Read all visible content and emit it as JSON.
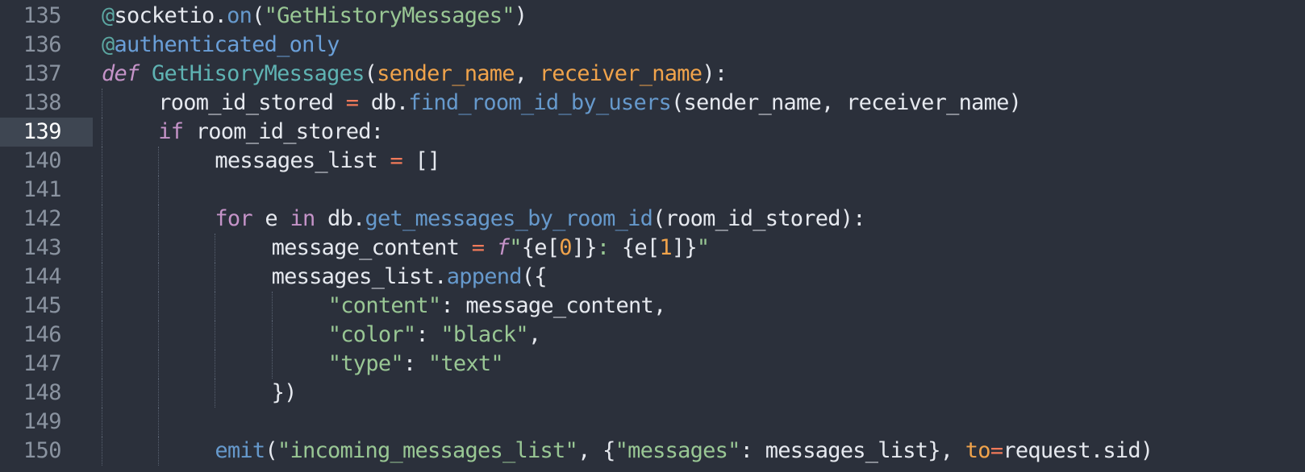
{
  "editor": {
    "active_line": "139",
    "lines": [
      {
        "number": "135",
        "indent": 0,
        "tokens": [
          {
            "c": "t-decorator",
            "t": "@"
          },
          {
            "c": "t-plain",
            "t": "socketio"
          },
          {
            "c": "t-punct",
            "t": "."
          },
          {
            "c": "t-method",
            "t": "on"
          },
          {
            "c": "t-punct",
            "t": "("
          },
          {
            "c": "t-string",
            "t": "\"GetHistoryMessages\""
          },
          {
            "c": "t-punct",
            "t": ")"
          }
        ]
      },
      {
        "number": "136",
        "indent": 0,
        "tokens": [
          {
            "c": "t-decorator",
            "t": "@"
          },
          {
            "c": "t-decorator-name",
            "t": "authenticated_only"
          }
        ]
      },
      {
        "number": "137",
        "indent": 0,
        "tokens": [
          {
            "c": "t-def",
            "t": "def"
          },
          {
            "c": "t-plain",
            "t": " "
          },
          {
            "c": "t-func",
            "t": "GetHisoryMessages"
          },
          {
            "c": "t-punct",
            "t": "("
          },
          {
            "c": "t-param",
            "t": "sender_name"
          },
          {
            "c": "t-punct",
            "t": ", "
          },
          {
            "c": "t-param",
            "t": "receiver_name"
          },
          {
            "c": "t-punct",
            "t": "):"
          }
        ]
      },
      {
        "number": "138",
        "indent": 1,
        "tokens": [
          {
            "c": "t-plain",
            "t": "room_id_stored "
          },
          {
            "c": "t-operator",
            "t": "="
          },
          {
            "c": "t-plain",
            "t": " db"
          },
          {
            "c": "t-punct",
            "t": "."
          },
          {
            "c": "t-method",
            "t": "find_room_id_by_users"
          },
          {
            "c": "t-punct",
            "t": "("
          },
          {
            "c": "t-plain",
            "t": "sender_name"
          },
          {
            "c": "t-punct",
            "t": ", "
          },
          {
            "c": "t-plain",
            "t": "receiver_name"
          },
          {
            "c": "t-punct",
            "t": ")"
          }
        ]
      },
      {
        "number": "139",
        "indent": 1,
        "tokens": [
          {
            "c": "t-keyword",
            "t": "if"
          },
          {
            "c": "t-plain",
            "t": " room_id_stored"
          },
          {
            "c": "t-punct",
            "t": ":"
          }
        ]
      },
      {
        "number": "140",
        "indent": 2,
        "tokens": [
          {
            "c": "t-plain",
            "t": "messages_list "
          },
          {
            "c": "t-operator",
            "t": "="
          },
          {
            "c": "t-punct",
            "t": " []"
          }
        ]
      },
      {
        "number": "141",
        "indent": 2,
        "tokens": []
      },
      {
        "number": "142",
        "indent": 2,
        "tokens": [
          {
            "c": "t-keyword",
            "t": "for"
          },
          {
            "c": "t-plain",
            "t": " e "
          },
          {
            "c": "t-keyword",
            "t": "in"
          },
          {
            "c": "t-plain",
            "t": " db"
          },
          {
            "c": "t-punct",
            "t": "."
          },
          {
            "c": "t-method",
            "t": "get_messages_by_room_id"
          },
          {
            "c": "t-punct",
            "t": "("
          },
          {
            "c": "t-plain",
            "t": "room_id_stored"
          },
          {
            "c": "t-punct",
            "t": "):"
          }
        ]
      },
      {
        "number": "143",
        "indent": 3,
        "tokens": [
          {
            "c": "t-plain",
            "t": "message_content "
          },
          {
            "c": "t-operator",
            "t": "="
          },
          {
            "c": "t-plain",
            "t": " "
          },
          {
            "c": "t-fstr",
            "t": "f"
          },
          {
            "c": "t-string",
            "t": "\""
          },
          {
            "c": "t-punct",
            "t": "{e["
          },
          {
            "c": "t-number",
            "t": "0"
          },
          {
            "c": "t-punct",
            "t": "]}"
          },
          {
            "c": "t-string",
            "t": ": "
          },
          {
            "c": "t-punct",
            "t": "{e["
          },
          {
            "c": "t-number",
            "t": "1"
          },
          {
            "c": "t-punct",
            "t": "]}"
          },
          {
            "c": "t-string",
            "t": "\""
          }
        ]
      },
      {
        "number": "144",
        "indent": 3,
        "tokens": [
          {
            "c": "t-plain",
            "t": "messages_list"
          },
          {
            "c": "t-punct",
            "t": "."
          },
          {
            "c": "t-method",
            "t": "append"
          },
          {
            "c": "t-punct",
            "t": "({"
          }
        ]
      },
      {
        "number": "145",
        "indent": 4,
        "tokens": [
          {
            "c": "t-string",
            "t": "\"content\""
          },
          {
            "c": "t-punct",
            "t": ": "
          },
          {
            "c": "t-plain",
            "t": "message_content"
          },
          {
            "c": "t-punct",
            "t": ","
          }
        ]
      },
      {
        "number": "146",
        "indent": 4,
        "tokens": [
          {
            "c": "t-string",
            "t": "\"color\""
          },
          {
            "c": "t-punct",
            "t": ": "
          },
          {
            "c": "t-string",
            "t": "\"black\""
          },
          {
            "c": "t-punct",
            "t": ","
          }
        ]
      },
      {
        "number": "147",
        "indent": 4,
        "tokens": [
          {
            "c": "t-string",
            "t": "\"type\""
          },
          {
            "c": "t-punct",
            "t": ": "
          },
          {
            "c": "t-string",
            "t": "\"text\""
          }
        ]
      },
      {
        "number": "148",
        "indent": 3,
        "tokens": [
          {
            "c": "t-punct",
            "t": "})"
          }
        ]
      },
      {
        "number": "149",
        "indent": 2,
        "tokens": []
      },
      {
        "number": "150",
        "indent": 2,
        "tokens": [
          {
            "c": "t-method",
            "t": "emit"
          },
          {
            "c": "t-punct",
            "t": "("
          },
          {
            "c": "t-string",
            "t": "\"incoming_messages_list\""
          },
          {
            "c": "t-punct",
            "t": ", {"
          },
          {
            "c": "t-string",
            "t": "\"messages\""
          },
          {
            "c": "t-punct",
            "t": ": "
          },
          {
            "c": "t-plain",
            "t": "messages_list"
          },
          {
            "c": "t-punct",
            "t": "}, "
          },
          {
            "c": "t-kwarg",
            "t": "to"
          },
          {
            "c": "t-operator",
            "t": "="
          },
          {
            "c": "t-plain",
            "t": "request"
          },
          {
            "c": "t-punct",
            "t": "."
          },
          {
            "c": "t-plain",
            "t": "sid"
          },
          {
            "c": "t-punct",
            "t": ")"
          }
        ]
      }
    ]
  }
}
